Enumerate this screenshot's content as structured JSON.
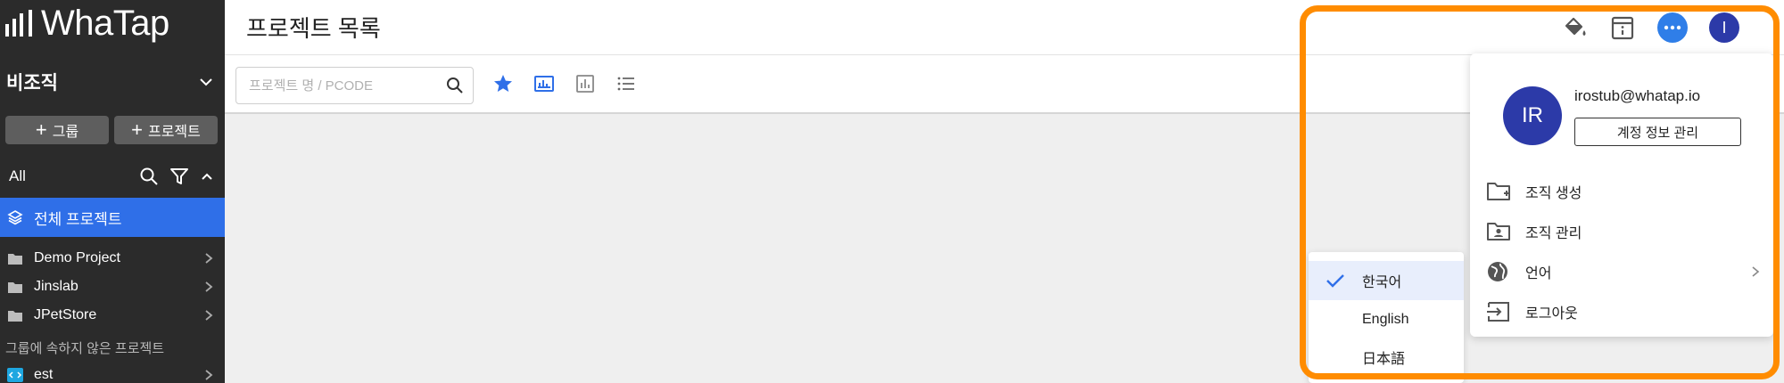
{
  "sidebar": {
    "logo_text": "WhaTap",
    "org_name": "비조직",
    "add_group_label": "그룹",
    "add_project_label": "프로젝트",
    "filter_label": "All",
    "all_projects_label": "전체 프로젝트",
    "projects": [
      {
        "name": "Demo Project"
      },
      {
        "name": "Jinslab"
      },
      {
        "name": "JPetStore"
      }
    ],
    "ungrouped_label": "그룹에 속하지 않은 프로젝트",
    "ungrouped_projects": [
      {
        "name": "est"
      }
    ]
  },
  "header": {
    "title": "프로젝트 목록",
    "avatar_initial": "I"
  },
  "toolbar": {
    "search_placeholder": "프로젝트 명 / PCODE"
  },
  "account_menu": {
    "avatar_initials": "IR",
    "email": "irostub@whatap.io",
    "manage_account_label": "계정 정보 관리",
    "items": [
      {
        "label": "조직 생성",
        "icon": "folder-plus-icon"
      },
      {
        "label": "조직 관리",
        "icon": "folder-user-icon"
      },
      {
        "label": "언어",
        "icon": "globe-icon"
      },
      {
        "label": "로그아웃",
        "icon": "logout-icon"
      }
    ]
  },
  "language_menu": {
    "items": [
      {
        "label": "한국어",
        "selected": true
      },
      {
        "label": "English",
        "selected": false
      },
      {
        "label": "日本語",
        "selected": false
      }
    ]
  },
  "colors": {
    "sidebar_bg": "#2b2b2b",
    "accent_blue": "#2f6fe8",
    "avatar_navy": "#2c3aa8",
    "highlight_orange": "#ff8c00"
  }
}
